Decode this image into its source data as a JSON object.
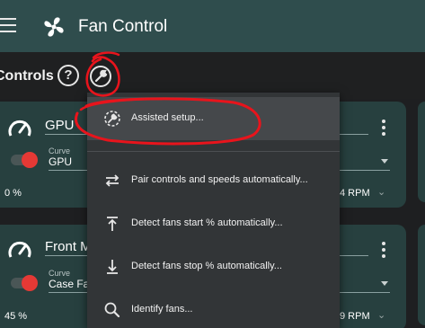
{
  "app": {
    "title": "Fan Control"
  },
  "section": {
    "title": "Controls",
    "help_glyph": "?"
  },
  "cards": [
    {
      "name": "GPU",
      "curve_label": "Curve",
      "curve_value": "GPU",
      "percent": "0 %",
      "rpm": "4 RPM"
    },
    {
      "name": "Front M",
      "curve_label": "Curve",
      "curve_value": "Case Fa",
      "percent": "45 %",
      "rpm": "9 RPM"
    }
  ],
  "menu": {
    "items": [
      {
        "label": "Assisted setup...",
        "icon": "wrench-icon"
      },
      {
        "label": "Pair controls and speeds automatically...",
        "icon": "swap-arrows-icon"
      },
      {
        "label": "Detect fans start % automatically...",
        "icon": "arrow-up-bar-icon"
      },
      {
        "label": "Detect fans stop % automatically...",
        "icon": "arrow-down-bar-icon"
      },
      {
        "label": "Identify fans...",
        "icon": "search-icon"
      }
    ]
  },
  "colors": {
    "topbar": "#2f4d4d",
    "card": "#27403f",
    "menu": "#323537",
    "toggle_knob": "#e53935",
    "annotation": "#e8141c"
  }
}
